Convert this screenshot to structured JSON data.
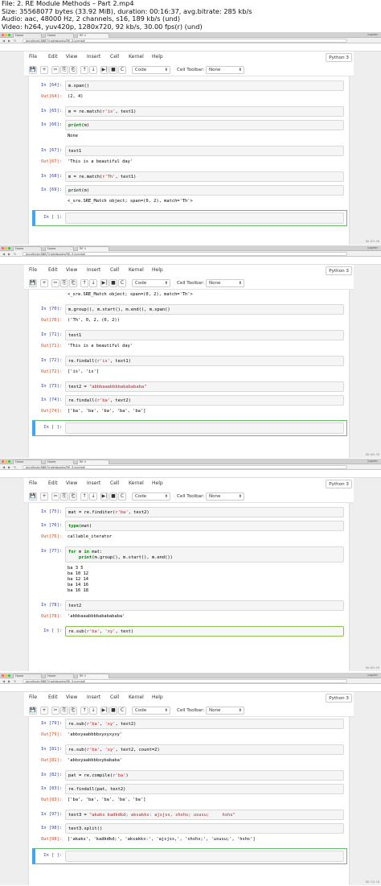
{
  "file_info": {
    "line1": "File: 2. RE Module Methods – Part 2.mp4",
    "line2": "Size: 35568077 bytes (33.92 MiB), duration: 00:16:37, avg.bitrate: 285 kb/s",
    "line3": "Audio: aac, 48000 Hz, 2 channels, s16, 189 kb/s (und)",
    "line4": "Video: h264, yuv420p, 1280x720, 92 kb/s, 30.00 fps(r) (und)"
  },
  "browser": {
    "tab_home": "Home",
    "tab_home2": "Home",
    "tab_re": "RE ii",
    "user": "Jupyter",
    "address": "localhost:8887/notebooks/RE-3.ipynb#"
  },
  "menu": {
    "file": "File",
    "edit": "Edit",
    "view": "View",
    "insert": "Insert",
    "cell": "Cell",
    "kernel": "Kernel",
    "help": "Help",
    "kernel_name": "Python 3"
  },
  "toolbar": {
    "cell_type": "Code",
    "cell_toolbar_label": "Cell Toolbar:",
    "cell_toolbar_value": "None",
    "btn_save": "💾",
    "btn_add": "+",
    "btn_cut": "✂",
    "btn_copy": "⎘",
    "btn_paste": "⎗",
    "btn_up": "↑",
    "btn_down": "↓",
    "btn_run": "▶|",
    "btn_stop": "■",
    "btn_restart": "C"
  },
  "frames": [
    {
      "timestamp": "00:03:20",
      "cells": [
        {
          "kind": "in",
          "prompt": "In [64]:",
          "code": "m.span()"
        },
        {
          "kind": "out",
          "prompt": "Out[64]:",
          "text": "(2, 4)"
        },
        {
          "kind": "in",
          "prompt": "In [65]:",
          "code": "m = re.match(r'is', text1)"
        },
        {
          "kind": "in",
          "prompt": "In [66]:",
          "code": "print(m)"
        },
        {
          "kind": "stream",
          "text": "None"
        },
        {
          "kind": "in",
          "prompt": "In [67]:",
          "code": "text1"
        },
        {
          "kind": "out",
          "prompt": "Out[67]:",
          "text": "'This is a beautiful day'"
        },
        {
          "kind": "in",
          "prompt": "In [68]:",
          "code": "m = re.match(r'Th', text1)"
        },
        {
          "kind": "in",
          "prompt": "In [69]:",
          "code": "print(m)"
        },
        {
          "kind": "stream",
          "text": "<_sre.SRE_Match object; span=(0, 2), match='Th'>"
        },
        {
          "kind": "empty",
          "prompt": "In [ ]:"
        }
      ]
    },
    {
      "timestamp": "00:06:39",
      "cells": [
        {
          "kind": "stream",
          "text": "<_sre.SRE_Match object; span=(0, 2), match='Th'>"
        },
        {
          "kind": "in",
          "prompt": "In [70]:",
          "code": "m.group(), m.start(), m.end(), m.span()"
        },
        {
          "kind": "out",
          "prompt": "Out[70]:",
          "text": "('Th', 0, 2, (0, 2))"
        },
        {
          "kind": "in",
          "prompt": "In [71]:",
          "code": "text1"
        },
        {
          "kind": "out",
          "prompt": "Out[71]:",
          "text": "'This is a beautiful day'"
        },
        {
          "kind": "in",
          "prompt": "In [72]:",
          "code": "re.findall(r'is', text1)"
        },
        {
          "kind": "out",
          "prompt": "Out[72]:",
          "text": "['is', 'is']"
        },
        {
          "kind": "in",
          "prompt": "In [73]:",
          "code": "text2 = \"abbbaaabbbbababababa\""
        },
        {
          "kind": "in",
          "prompt": "In [74]:",
          "code": "re.findall(r'ba', text2)"
        },
        {
          "kind": "out",
          "prompt": "Out[74]:",
          "text": "['ba', 'ba', 'ba', 'ba', 'ba']"
        },
        {
          "kind": "empty",
          "prompt": "In [ ]:"
        }
      ]
    },
    {
      "timestamp": "00:09:59",
      "cells": [
        {
          "kind": "in",
          "prompt": "In [75]:",
          "code": "mat = re.finditer(r'ba', text2)"
        },
        {
          "kind": "in",
          "prompt": "In [76]:",
          "code": "type(mat)"
        },
        {
          "kind": "out",
          "prompt": "Out[76]:",
          "text": "callable_iterator"
        },
        {
          "kind": "in",
          "prompt": "In [77]:",
          "code": "for m in mat:"
        },
        {
          "kind": "cont",
          "code": "    print(m.group(), m.start(), m.end())"
        },
        {
          "kind": "stream",
          "text": "ba 3 5"
        },
        {
          "kind": "stream",
          "text": "ba 10 12"
        },
        {
          "kind": "stream",
          "text": "ba 12 14"
        },
        {
          "kind": "stream",
          "text": "ba 14 16"
        },
        {
          "kind": "stream",
          "text": "ba 16 18"
        },
        {
          "kind": "in",
          "prompt": "In [78]:",
          "code": "text2"
        },
        {
          "kind": "out",
          "prompt": "Out[78]:",
          "text": "'abbbaaabbbbababababa'"
        },
        {
          "kind": "in",
          "prompt": "In [ ]:",
          "code": "re.sub(r'ba', 'xy', text)"
        }
      ]
    },
    {
      "timestamp": "00:13:18",
      "cells": [
        {
          "kind": "in",
          "prompt": "In [79]:",
          "code": "re.sub(r'ba', 'xy', text2)"
        },
        {
          "kind": "out",
          "prompt": "Out[79]:",
          "text": "'abbxyaabbbbxyxyxyxy'"
        },
        {
          "kind": "in",
          "prompt": "In [81]:",
          "code": "re.sub(r'ba', 'xy', text2, count=2)"
        },
        {
          "kind": "out",
          "prompt": "Out[81]:",
          "text": "'abbxyaabbbbxybababa'"
        },
        {
          "kind": "in",
          "prompt": "In [82]:",
          "code": "pat = re.compile(r'ba')"
        },
        {
          "kind": "in",
          "prompt": "In [83]:",
          "code": "re.findall(pat, text2)"
        },
        {
          "kind": "out",
          "prompt": "Out[83]:",
          "text": "['ba', 'ba', 'ba', 'ba', 'ba']"
        },
        {
          "kind": "in",
          "prompt": "In [97]:",
          "code": "text3 = \"akaks kadkdkd; aksakks: ajsjss, shshs; ususu;     hshs\""
        },
        {
          "kind": "in",
          "prompt": "In [98]:",
          "code": "text3.split()"
        },
        {
          "kind": "out",
          "prompt": "Out[98]:",
          "text": "['akaks', 'kadkdkd;', 'aksakks:', 'ajsjss,', 'shshs;', 'ususu;', 'hshs']"
        },
        {
          "kind": "empty",
          "prompt": "In [ ]:"
        }
      ]
    }
  ]
}
